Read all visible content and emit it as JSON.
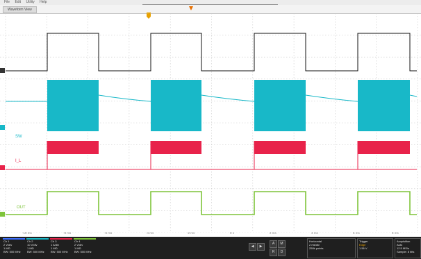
{
  "menu": [
    "File",
    "Edit",
    "Utility",
    "Help"
  ],
  "window_tab": "Waveform View",
  "channels": [
    {
      "label": "CH1",
      "name": "",
      "color": "#3d6fff"
    },
    {
      "label": "CH2",
      "name": "SW",
      "color": "#18b8c8"
    },
    {
      "label": "CH3",
      "name": "I_L",
      "color": "#e8224a"
    },
    {
      "label": "CH4",
      "name": "OUT",
      "color": "#7ec43a"
    }
  ],
  "time_ruler": [
    "-10 ms",
    "-8 ms",
    "-6 ms",
    "-4 ms",
    "-2 ms",
    "0 s",
    "2 ms",
    "4 ms",
    "6 ms",
    "8 ms",
    "10 ms"
  ],
  "channel_settings": [
    {
      "title": "Ch 1",
      "lines": [
        "2 V/div",
        "1 MΩ",
        "BW: 500 MHz"
      ]
    },
    {
      "title": "Ch 2",
      "lines": [
        "10 V/div",
        "1 MΩ",
        "BW: 500 MHz"
      ]
    },
    {
      "title": "Ch 3",
      "lines": [
        "1 A/div",
        "1 MΩ",
        "BW: 500 MHz"
      ]
    },
    {
      "title": "Ch 4",
      "lines": [
        "2 V/div",
        "1 MΩ",
        "BW: 500 MHz"
      ]
    }
  ],
  "acquisition": {
    "title": "Acquisition",
    "lines": [
      "Auto",
      "2 ms/div",
      "12.5 MS/s",
      "Sample: 8 bits"
    ]
  },
  "trigger": {
    "title": "Trigger",
    "lines": [
      "Edge",
      "1.56 V"
    ]
  },
  "horizontal": {
    "title": "Horizontal",
    "lines": [
      "2 ms/div",
      "250k points"
    ]
  },
  "control_buttons": [
    "◀",
    "▶",
    "A",
    "M",
    "R",
    "D"
  ],
  "colors": {
    "ch1": "#3d6fff",
    "ch2": "#18b8c8",
    "ch3": "#e8224a",
    "ch4": "#7ec43a",
    "trigger": "#e8a100"
  }
}
